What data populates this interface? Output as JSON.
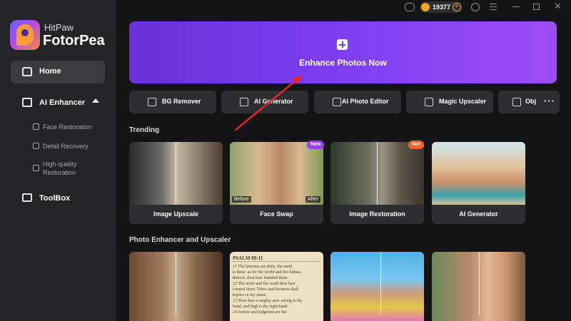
{
  "brand": {
    "line1": "HitPaw",
    "line2": "FotorPea"
  },
  "sidebar": {
    "home": "Home",
    "ai_enhancer": "AI Enhancer",
    "sub_items": [
      "Face Restoration",
      "Detail Recovery",
      "High-quality",
      "Restoration"
    ],
    "toolbox": "ToolBox"
  },
  "titlebar": {
    "coins": "19377"
  },
  "hero": {
    "cta": "Enhance Photos Now"
  },
  "tools": [
    "BG Remover",
    "AI Generator",
    "AI Photo Editor",
    "Magic Upscaler",
    "Obj"
  ],
  "sections": {
    "trending": "Trending",
    "photo": "Photo Enhancer and Upscaler"
  },
  "trending_cards": [
    {
      "title": "Image Upscale"
    },
    {
      "title": "Face Swap",
      "badge": "New",
      "before": "Before",
      "after": "After"
    },
    {
      "title": "Image Restoration",
      "badge": "Hot"
    },
    {
      "title": "AI Generator"
    }
  ],
  "psalm": {
    "header": "PSALM 89:11",
    "lines": [
      "11 The heavens are thine, the earth",
      "is thine: as for the world and the fulness",
      "thereof, thou hast founded them.",
      "12 The north and the south thou hast",
      "created them: Tabor and Hermon shall",
      "rejoice in thy name.",
      "13 Thou hast a mighty arm: strong is thy",
      "hand, and high is thy right hand.",
      "14 Justice and judgment are the"
    ]
  },
  "colors": {
    "accent": "#7b3ced",
    "badge_new": "#9b3df0",
    "badge_hot": "#f0622e",
    "arrow": "#e0262b"
  }
}
